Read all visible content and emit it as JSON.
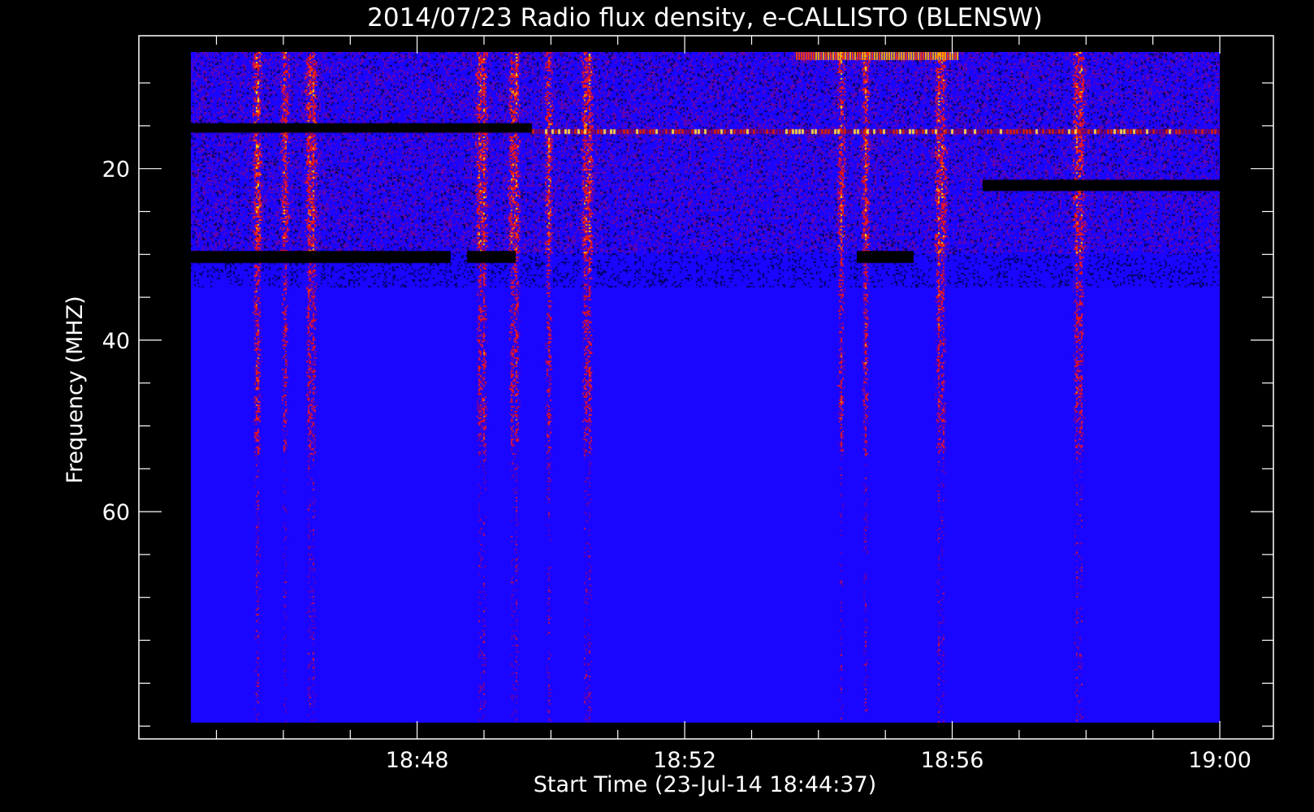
{
  "chart_data": {
    "type": "heatmap",
    "title": "2014/07/23  Radio flux density, e-CALLISTO (BLENSW)",
    "xlabel": "Start Time (23-Jul-14 18:44:37)",
    "ylabel": "Frequency (MHZ)",
    "x_ticks": [
      "18:48",
      "18:52",
      "18:56",
      "19:00"
    ],
    "x_tick_minutes": [
      48,
      52,
      56,
      60
    ],
    "x_range_minutes": [
      44.617,
      60
    ],
    "y_ticks": [
      "20",
      "40",
      "60"
    ],
    "y_tick_values": [
      20,
      40,
      60
    ],
    "y_range": [
      4.5,
      86.5
    ],
    "y_inverted": true,
    "colormap": [
      "#000000",
      "#1a00ff",
      "#2000ff",
      "#7a0080",
      "#d01a00",
      "#ff8a00",
      "#ffe060"
    ],
    "background_color": "#000000",
    "plot_color": "#1a05ff",
    "grid": false,
    "legend": "none"
  }
}
